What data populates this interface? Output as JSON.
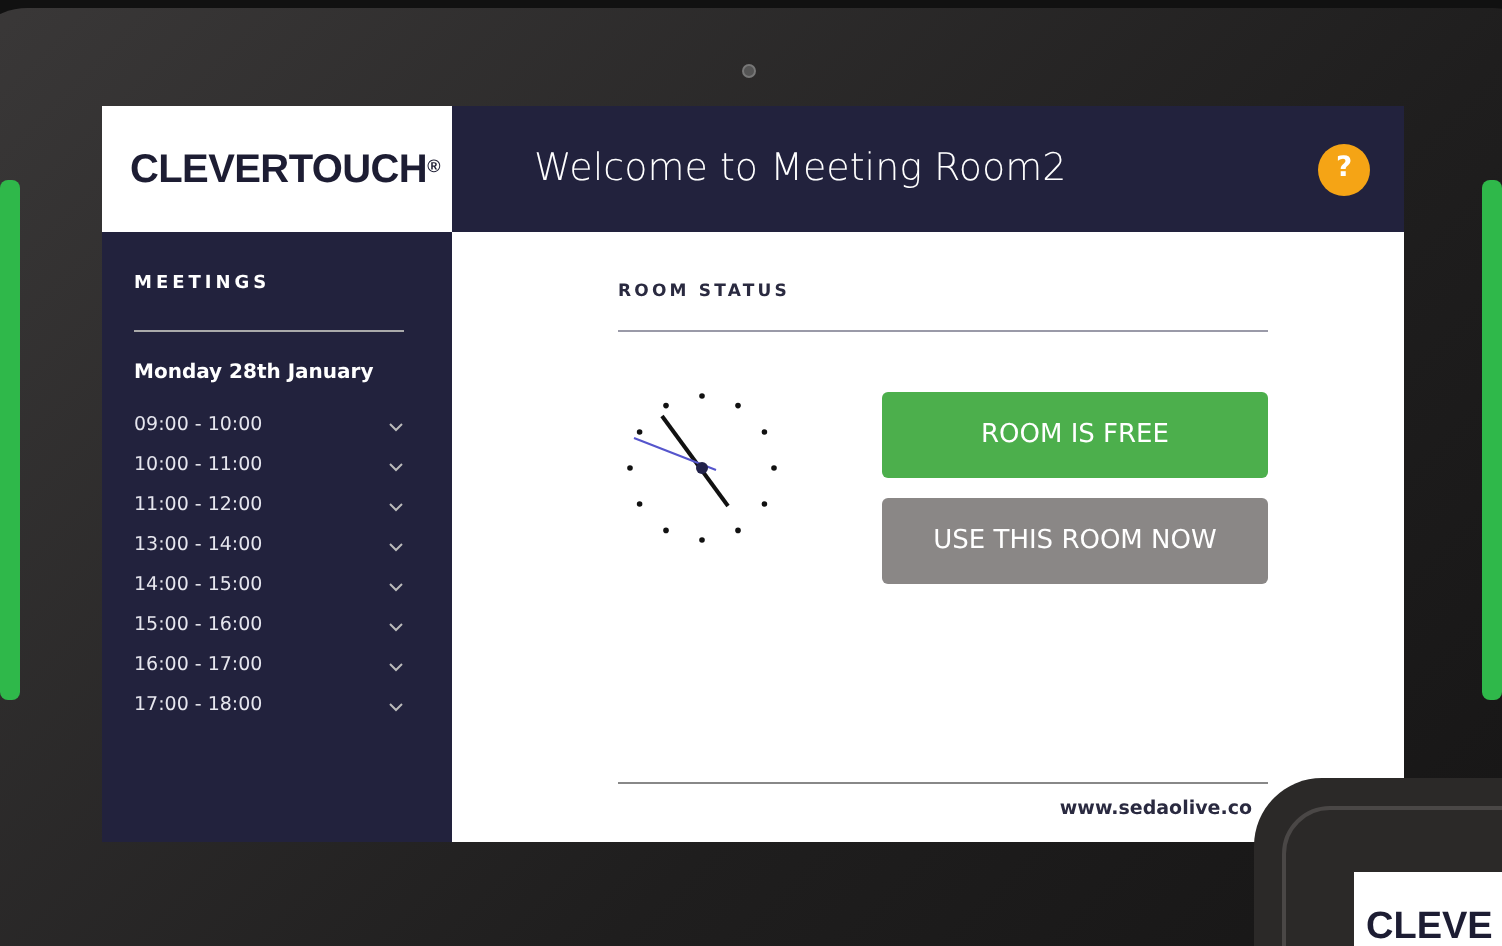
{
  "header": {
    "logo": "CLEVERTOUCH$^{®}$",
    "title": "Welcome to Meeting Room2",
    "help": "?"
  },
  "sidebar": {
    "heading": "MEETINGS",
    "date": "Monday 28th January",
    "meetings": [
      {
        "time": "09:00 - 10:00"
      },
      {
        "time": "10:00 - 11:00"
      },
      {
        "time": "11:00 - 12:00"
      },
      {
        "time": "13:00 - 14:00"
      },
      {
        "time": "14:00 - 15:00"
      },
      {
        "time": "15:00 - 16:00"
      },
      {
        "time": "16:00 - 17:00"
      },
      {
        "time": "17:00 - 18:00"
      }
    ]
  },
  "main": {
    "heading": "ROOM STATUS",
    "buttons": [
      {
        "label": "ROOM IS FREE",
        "kind": "status"
      },
      {
        "label": "USE THIS ROOM NOW",
        "kind": "action"
      }
    ],
    "footer_url": "www.sedaolive.co"
  },
  "second_device": {
    "logo": "CLEVE"
  }
}
